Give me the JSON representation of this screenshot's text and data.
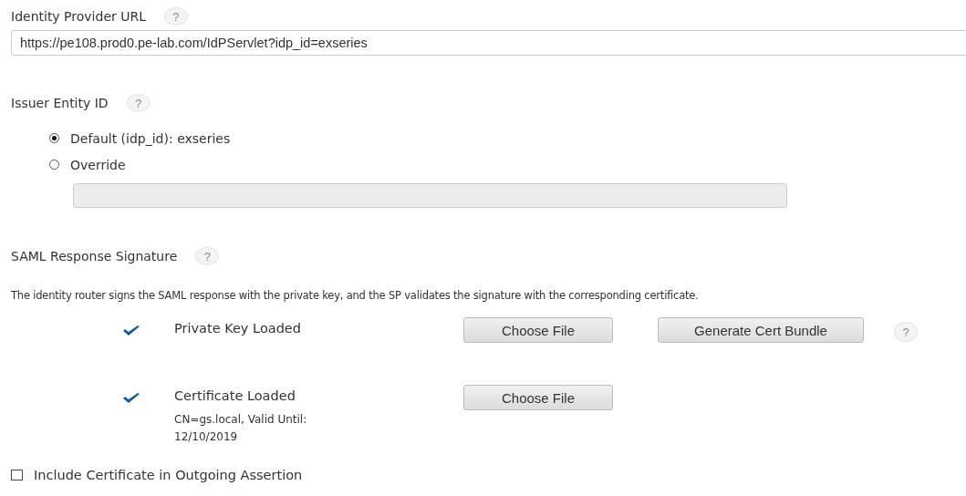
{
  "identity_provider_url": {
    "label": "Identity Provider URL",
    "help": "?",
    "value": "https://pe108.prod0.pe-lab.com/IdPServlet?idp_id=exseries"
  },
  "issuer_entity_id": {
    "label": "Issuer Entity ID",
    "help": "?",
    "options": [
      {
        "label": "Default (idp_id): exseries",
        "selected": true
      },
      {
        "label": "Override",
        "selected": false
      }
    ],
    "override_field": {
      "disabled": true
    }
  },
  "saml_response_signature": {
    "label": "SAML Response Signature",
    "help": "?",
    "description": "The identity router signs the SAML response with the private key, and the SP validates the signature with the corresponding certificate.",
    "items": [
      {
        "label": "Private Key Loaded",
        "loaded": true,
        "buttons": [
          "Choose File",
          "Generate Cert Bundle"
        ],
        "help": "?"
      },
      {
        "label": "Certificate Loaded",
        "loaded": true,
        "detail": "CN=gs.local, Valid Until: 12/10/2019",
        "buttons": [
          "Choose File"
        ]
      }
    ]
  },
  "include_certificate": {
    "label": "Include Certificate in Outgoing Assertion",
    "checked": false
  }
}
